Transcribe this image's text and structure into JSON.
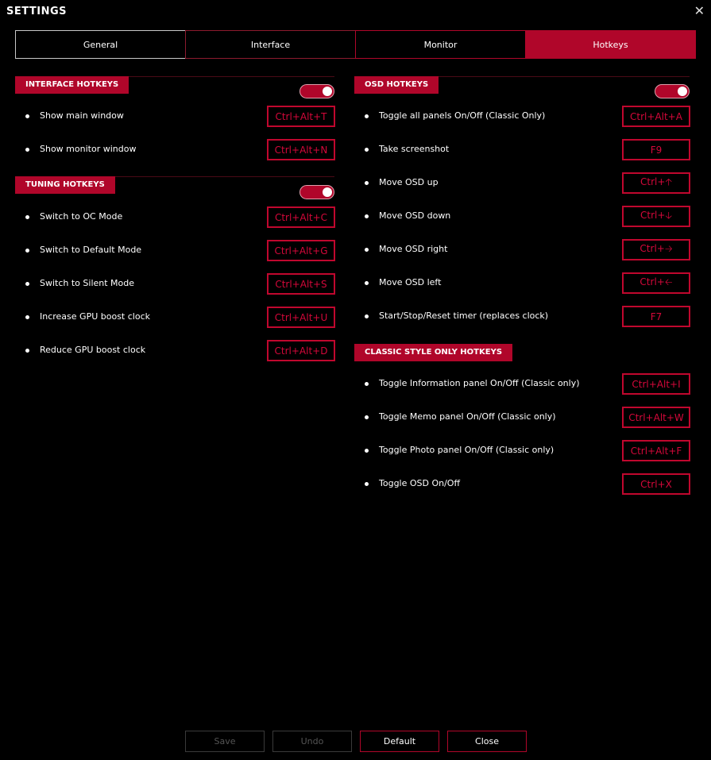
{
  "window": {
    "title": "SETTINGS",
    "close_glyph": "✕"
  },
  "tabs": [
    {
      "label": "General",
      "active": false
    },
    {
      "label": "Interface",
      "active": false
    },
    {
      "label": "Monitor",
      "active": false
    },
    {
      "label": "Hotkeys",
      "active": true
    }
  ],
  "interface_hotkeys": {
    "title": "INTERFACE HOTKEYS",
    "enabled": true,
    "items": [
      {
        "label": "Show main window",
        "key": "Ctrl+Alt+T"
      },
      {
        "label": "Show monitor window",
        "key": "Ctrl+Alt+N"
      }
    ]
  },
  "tuning_hotkeys": {
    "title": "TUNING HOTKEYS",
    "enabled": true,
    "items": [
      {
        "label": "Switch to OC Mode",
        "key": "Ctrl+Alt+C"
      },
      {
        "label": "Switch to Default Mode",
        "key": "Ctrl+Alt+G"
      },
      {
        "label": "Switch to Silent Mode",
        "key": "Ctrl+Alt+S"
      },
      {
        "label": "Increase GPU boost clock",
        "key": "Ctrl+Alt+U"
      },
      {
        "label": "Reduce GPU boost clock",
        "key": "Ctrl+Alt+D"
      }
    ]
  },
  "osd_hotkeys": {
    "title": "OSD HOTKEYS",
    "enabled": true,
    "items": [
      {
        "label": "Toggle all panels On/Off (Classic Only)",
        "key": "Ctrl+Alt+A"
      },
      {
        "label": "Take screenshot",
        "key": "F9"
      },
      {
        "label": "Move OSD up",
        "key": "Ctrl+🡡"
      },
      {
        "label": "Move OSD down",
        "key": "Ctrl+🡣"
      },
      {
        "label": "Move OSD right",
        "key": "Ctrl+🡢"
      },
      {
        "label": "Move OSD left",
        "key": "Ctrl+🡠"
      },
      {
        "label": "Start/Stop/Reset timer (replaces clock)",
        "key": "F7"
      }
    ]
  },
  "classic_hotkeys": {
    "title": "CLASSIC STYLE ONLY HOTKEYS",
    "items": [
      {
        "label": "Toggle Information panel On/Off (Classic only)",
        "key": "Ctrl+Alt+I"
      },
      {
        "label": "Toggle Memo panel On/Off (Classic only)",
        "key": "Ctrl+Alt+W"
      },
      {
        "label": "Toggle Photo panel On/Off (Classic only)",
        "key": "Ctrl+Alt+F"
      },
      {
        "label": "Toggle OSD On/Off",
        "key": "Ctrl+X"
      }
    ]
  },
  "footer": {
    "save": "Save",
    "undo": "Undo",
    "default": "Default",
    "close": "Close"
  },
  "colors": {
    "accent": "#b0062a",
    "key_text": "#d4083a"
  }
}
